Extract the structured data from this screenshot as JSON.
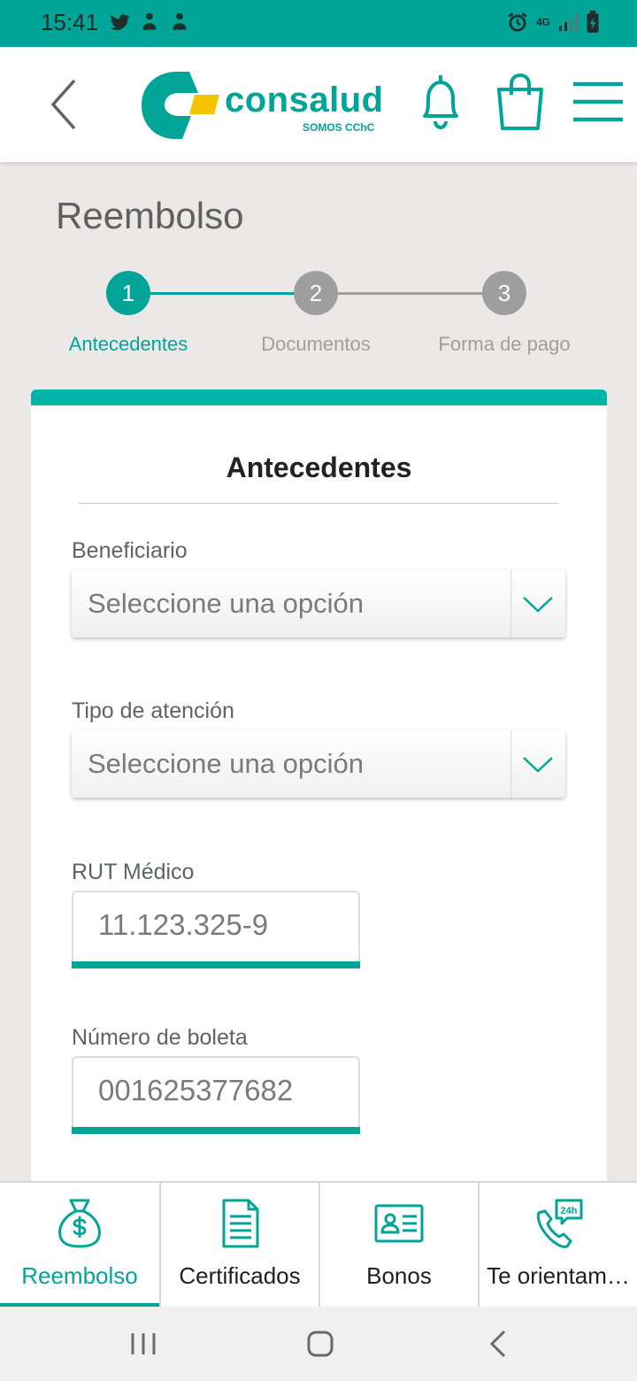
{
  "status_bar": {
    "time": "15:41",
    "network": "4G"
  },
  "header": {
    "logo_text": "consalud",
    "logo_sub": "SOMOS CChC",
    "icons": [
      "back-icon",
      "bell-icon",
      "shopping-bag-icon",
      "menu-icon"
    ]
  },
  "page": {
    "title": "Reembolso"
  },
  "stepper": {
    "current_step": 1,
    "steps": [
      {
        "number": "1",
        "label": "Antecedentes"
      },
      {
        "number": "2",
        "label": "Documentos"
      },
      {
        "number": "3",
        "label": "Forma de pago"
      }
    ]
  },
  "form": {
    "title": "Antecedentes",
    "beneficiario": {
      "label": "Beneficiario",
      "placeholder": "Seleccione una opción"
    },
    "tipo_atencion": {
      "label": "Tipo de atención",
      "placeholder": "Seleccione una opción"
    },
    "rut_medico": {
      "label": "RUT Médico",
      "value": "11.123.325-9"
    },
    "numero_boleta": {
      "label": "Número de boleta",
      "value": "001625377682"
    }
  },
  "bottom_nav": {
    "active": "Reembolso",
    "items": [
      {
        "label": "Reembolso",
        "icon": "money-bag-icon"
      },
      {
        "label": "Certificados",
        "icon": "document-icon"
      },
      {
        "label": "Bonos",
        "icon": "id-card-icon"
      },
      {
        "label": "Te orientam…",
        "icon": "phone-24h-icon"
      }
    ]
  },
  "colors": {
    "primary": "#00a598",
    "accent_yellow": "#f5c200",
    "inactive_step": "#9e9e9e",
    "background": "#ece8e8"
  }
}
